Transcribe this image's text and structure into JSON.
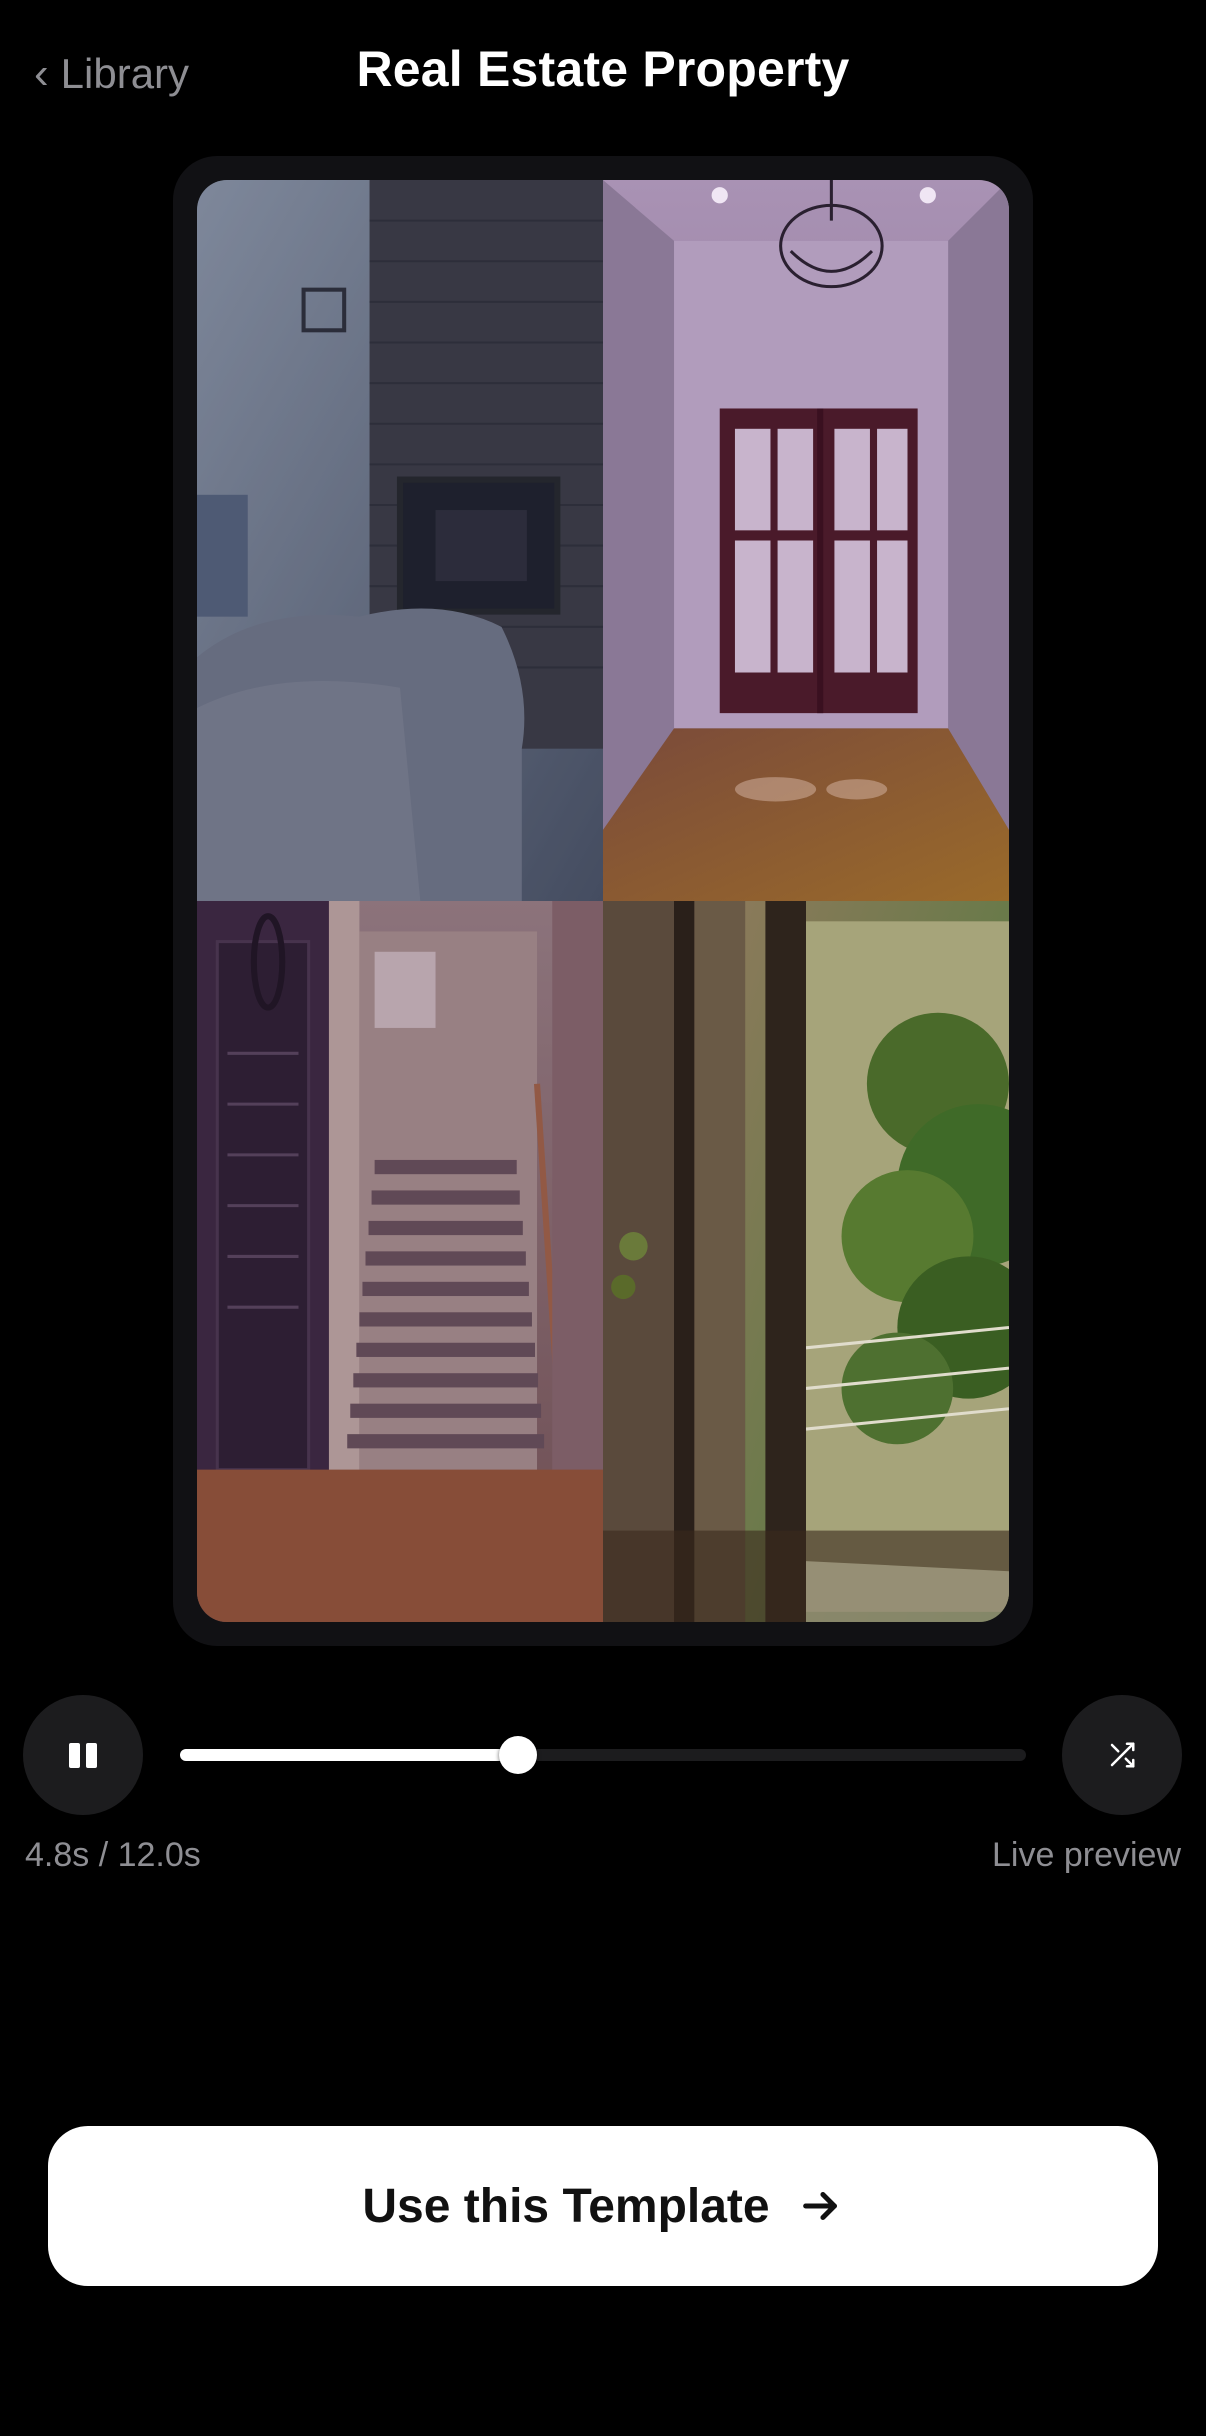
{
  "header": {
    "back_label": "Library",
    "title": "Real Estate Property"
  },
  "preview": {
    "tiles": [
      {
        "name": "living-room-fireplace",
        "tint": "#4a5a7a"
      },
      {
        "name": "hallway-french-doors",
        "tint": "#7a5a8a"
      },
      {
        "name": "staircase",
        "tint": "#8a5a5a"
      },
      {
        "name": "garden-door",
        "tint": "#6a8a4a"
      }
    ]
  },
  "player": {
    "progress": 0.4,
    "time_text": "4.8s / 12.0s",
    "status_text": "Live preview",
    "play_icon": "pause-icon",
    "shuffle_icon": "shuffle-icon"
  },
  "cta": {
    "label": "Use this Template",
    "icon": "arrow-right-icon"
  }
}
